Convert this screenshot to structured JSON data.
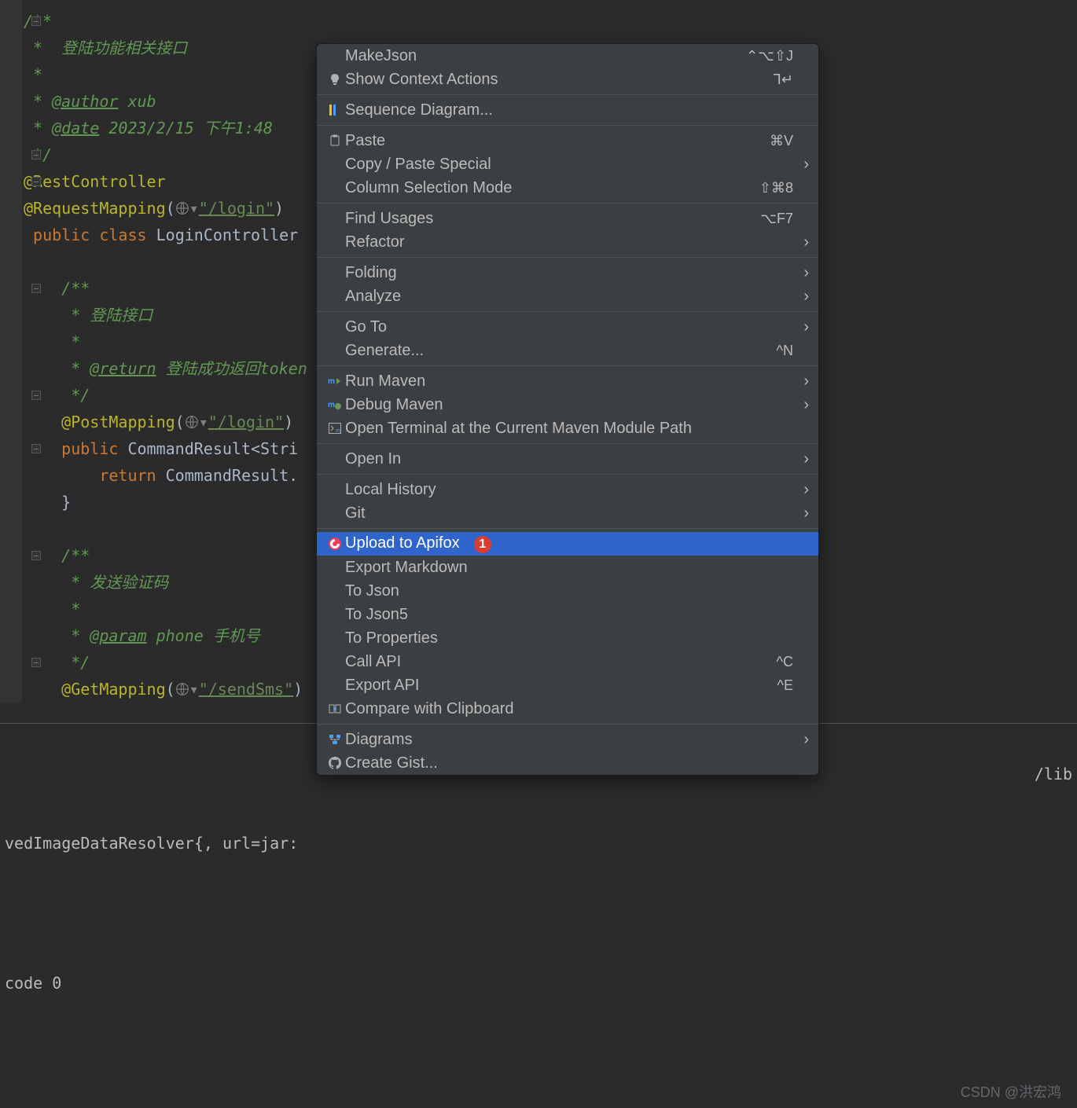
{
  "code": {
    "c1": "/**",
    "c2": " *  登陆功能相关接口",
    "c3": " *",
    "c4_pre": " * ",
    "c4_tag": "@author",
    "c4_val": " xub",
    "c5_pre": " * ",
    "c5_tag": "@date",
    "c5_val": " 2023/2/15 下午1:48",
    "c6": " */",
    "a1": "@RestController",
    "a2": "@RequestMapping",
    "a2_str": "\"/login\"",
    "cls_kw1": "public",
    "cls_kw2": "class",
    "cls_name": "LoginController ",
    "d1": "/**",
    "d2": " * 登陆接口",
    "d3": " *",
    "d4_pre": " * ",
    "d4_tag": "@return",
    "d4_val": " 登陆成功返回token",
    "d5": " */",
    "a3": "@PostMapping",
    "a3_str": "\"/login\"",
    "m1_kw": "public",
    "m1_sig": " CommandResult<Stri",
    "m2_kw": "return",
    "m2_sig": " CommandResult.",
    "m3": "}",
    "e1": "/**",
    "e2": " * 发送验证码",
    "e3": " *",
    "e4_pre": " * ",
    "e4_tag": "@param",
    "e4_var": " phone",
    "e4_desc": " 手机号",
    "e5": " */",
    "a4": "@GetMapping",
    "a4_str": "\"/sendSms\""
  },
  "console": {
    "line1": "vedImageDataResolver{, url=jar:",
    "right": "/lib",
    "line2": "code 0"
  },
  "menu": {
    "makeJson": "MakeJson",
    "makeJson_sc": "⌃⌥⇧J",
    "showContext": "Show Context Actions",
    "showContext_sc": "⅂↵",
    "seqDiagram": "Sequence Diagram...",
    "paste": "Paste",
    "paste_sc": "⌘V",
    "copyPaste": "Copy / Paste Special",
    "colSel": "Column Selection Mode",
    "colSel_sc": "⇧⌘8",
    "findUsages": "Find Usages",
    "findUsages_sc": "⌥F7",
    "refactor": "Refactor",
    "folding": "Folding",
    "analyze": "Analyze",
    "goto": "Go To",
    "generate": "Generate...",
    "generate_sc": "^N",
    "runMaven": "Run Maven",
    "debugMaven": "Debug Maven",
    "openTerminal": "Open Terminal at the Current Maven Module Path",
    "openIn": "Open In",
    "localHistory": "Local History",
    "git": "Git",
    "uploadApifox": "Upload to Apifox",
    "badge": "1",
    "exportMd": "Export Markdown",
    "toJson": "To Json",
    "toJson5": "To Json5",
    "toProps": "To Properties",
    "callApi": "Call API",
    "callApi_sc": "^C",
    "exportApi": "Export API",
    "exportApi_sc": "^E",
    "compareClip": "Compare with Clipboard",
    "diagrams": "Diagrams",
    "createGist": "Create Gist..."
  },
  "watermark": "CSDN @洪宏鸿"
}
